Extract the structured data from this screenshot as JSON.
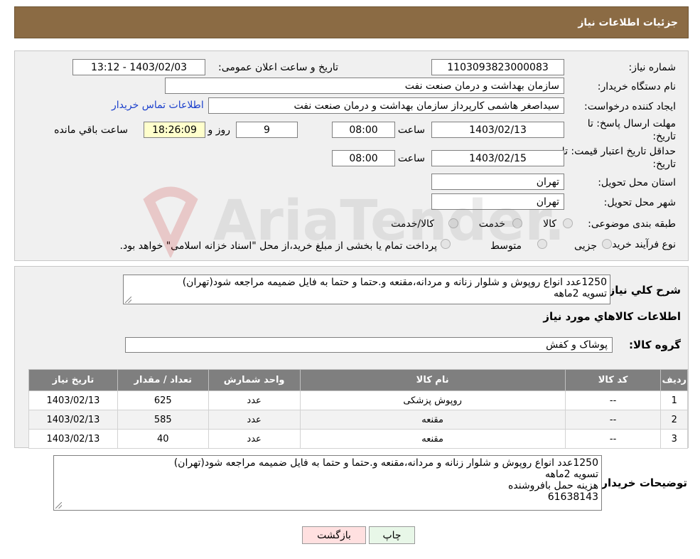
{
  "header": {
    "title": "جزئیات اطلاعات نیاز"
  },
  "form": {
    "need_number_label": "شماره نیاز:",
    "need_number": "1103093823000083",
    "announce_label": "تاریخ و ساعت اعلان عمومی:",
    "announce_value": "1403/02/03 - 13:12",
    "buyer_org_label": "نام دستگاه خریدار:",
    "buyer_org": "سازمان بهداشت و درمان صنعت نفت",
    "creator_label": "ایجاد کننده درخواست:",
    "creator": "سیداصغر هاشمی کارپرداز سازمان بهداشت و درمان صنعت نفت",
    "contact_link": "اطلاعات تماس خریدار",
    "deadline_label_1": "مهلت ارسال پاسخ: تا",
    "deadline_label_2": "تاریخ:",
    "deadline_date": "1403/02/13",
    "time_label": "ساعت",
    "deadline_time": "08:00",
    "days_value": "9",
    "days_label": "روز و",
    "remaining_time": "18:26:09",
    "remaining_label": "ساعت باقي مانده",
    "validity_label_1": "حداقل تاریخ اعتبار قیمت: تا",
    "validity_label_2": "تاریخ:",
    "validity_date": "1403/02/15",
    "validity_time": "08:00",
    "province_label": "استان محل تحویل:",
    "province": "تهران",
    "city_label": "شهر محل تحویل:",
    "city": "تهران",
    "category_label": "طبقه بندی موضوعی:",
    "category_options": [
      "کالا",
      "خدمت",
      "کالا/خدمت"
    ],
    "process_label": "نوع فرآیند خرید :",
    "process_options": [
      "جزیی",
      "متوسط"
    ],
    "process_note": "پرداخت تمام یا بخشی از مبلغ خرید،از محل \"اسناد خزانه اسلامی\" خواهد بود."
  },
  "summary": {
    "label": "شرح کلي نياز:",
    "text": "1250عدد انواع روپوش و شلوار زنانه و مردانه،مقنعه و.حتما و حتما به فایل ضمیمه مراجعه شود(تهران)\nتسویه 2ماهه",
    "goods_info_title": "اطلاعات کالاهاي مورد نياز",
    "group_label": "گروه کالا:",
    "group_value": "پوشاک و کفش"
  },
  "table": {
    "headers": [
      "رديف",
      "کد کالا",
      "نام کالا",
      "واحد شمارش",
      "تعداد / مقدار",
      "تاریخ نیاز"
    ],
    "rows": [
      [
        "1",
        "--",
        "روپوش پزشکی",
        "عدد",
        "625",
        "1403/02/13"
      ],
      [
        "2",
        "--",
        "مقنعه",
        "عدد",
        "585",
        "1403/02/13"
      ],
      [
        "3",
        "--",
        "مقنعه",
        "عدد",
        "40",
        "1403/02/13"
      ]
    ]
  },
  "buyer_notes": {
    "label": "توضیحات خریدار:",
    "text": "1250عدد انواع روپوش و شلوار زنانه و مردانه،مقنعه و.حتما و حتما به فایل ضمیمه مراجعه شود(تهران)\nتسویه 2ماهه\nهزینه حمل بافروشنده\n61638143"
  },
  "buttons": {
    "print": "چاپ",
    "back": "بازگشت"
  },
  "colors": {
    "header_bg": "#8b6b44",
    "table_header_bg": "#7f7f7f",
    "back_btn_bg": "#ffe0e0",
    "print_btn_bg": "#e8f7e8",
    "link": "#1a3fcc"
  },
  "watermark": {
    "text": "AriaTender.neT"
  }
}
